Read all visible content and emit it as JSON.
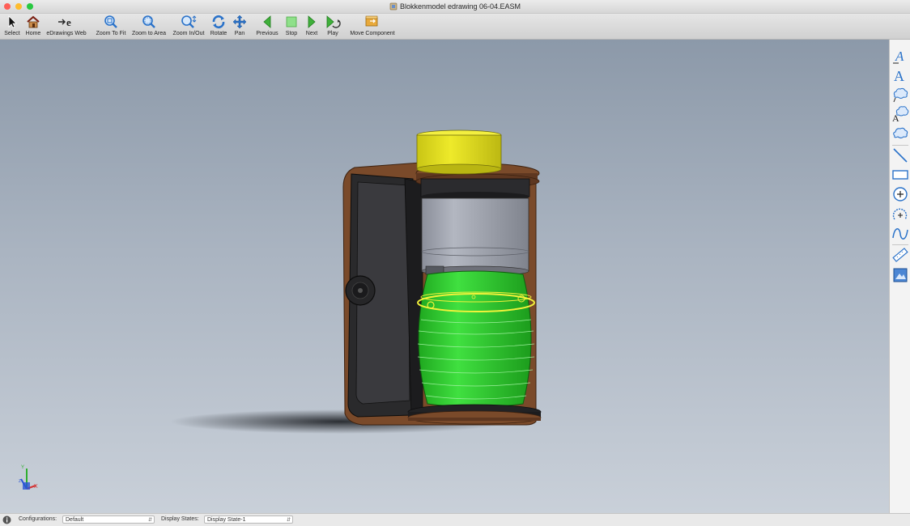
{
  "window": {
    "title": "Blokkenmodel edrawing 06-04.EASM",
    "traffic_colors": [
      "#fe5f57",
      "#febc2e",
      "#28c840"
    ]
  },
  "toolbar": {
    "select": "Select",
    "home": "Home",
    "edrawings_web": "eDrawings Web",
    "zoom_to_fit": "Zoom To Fit",
    "zoom_to_area": "Zoom to Area",
    "zoom_in_out": "Zoom In/Out",
    "rotate": "Rotate",
    "pan": "Pan",
    "previous": "Previous",
    "stop": "Stop",
    "next": "Next",
    "play": "Play",
    "move_component": "Move Component"
  },
  "right_toolbar": {
    "icons": [
      "text-icon",
      "text-bold-icon",
      "cloud-text-icon",
      "cloud-leader-icon",
      "cloud-icon",
      "line-icon",
      "rectangle-icon",
      "circle-icon",
      "arc-icon",
      "spline-icon",
      "measure-icon",
      "stamp-icon"
    ]
  },
  "viewport": {
    "model": "assembly-3d-model",
    "background_top": "#8c99a9",
    "background_bottom": "#c9d0d9",
    "triad": {
      "x": "X",
      "y": "Y",
      "z": "Z"
    }
  },
  "statusbar": {
    "configurations_label": "Configurations:",
    "configurations_value": "Default",
    "display_states_label": "Display States:",
    "display_states_value": "Display State-1"
  },
  "colors": {
    "accent_blue": "#2a72c9",
    "barrel_green": "#33d133",
    "cap_yellow": "#e3e01a",
    "wood_brown": "#7a4a2a"
  }
}
